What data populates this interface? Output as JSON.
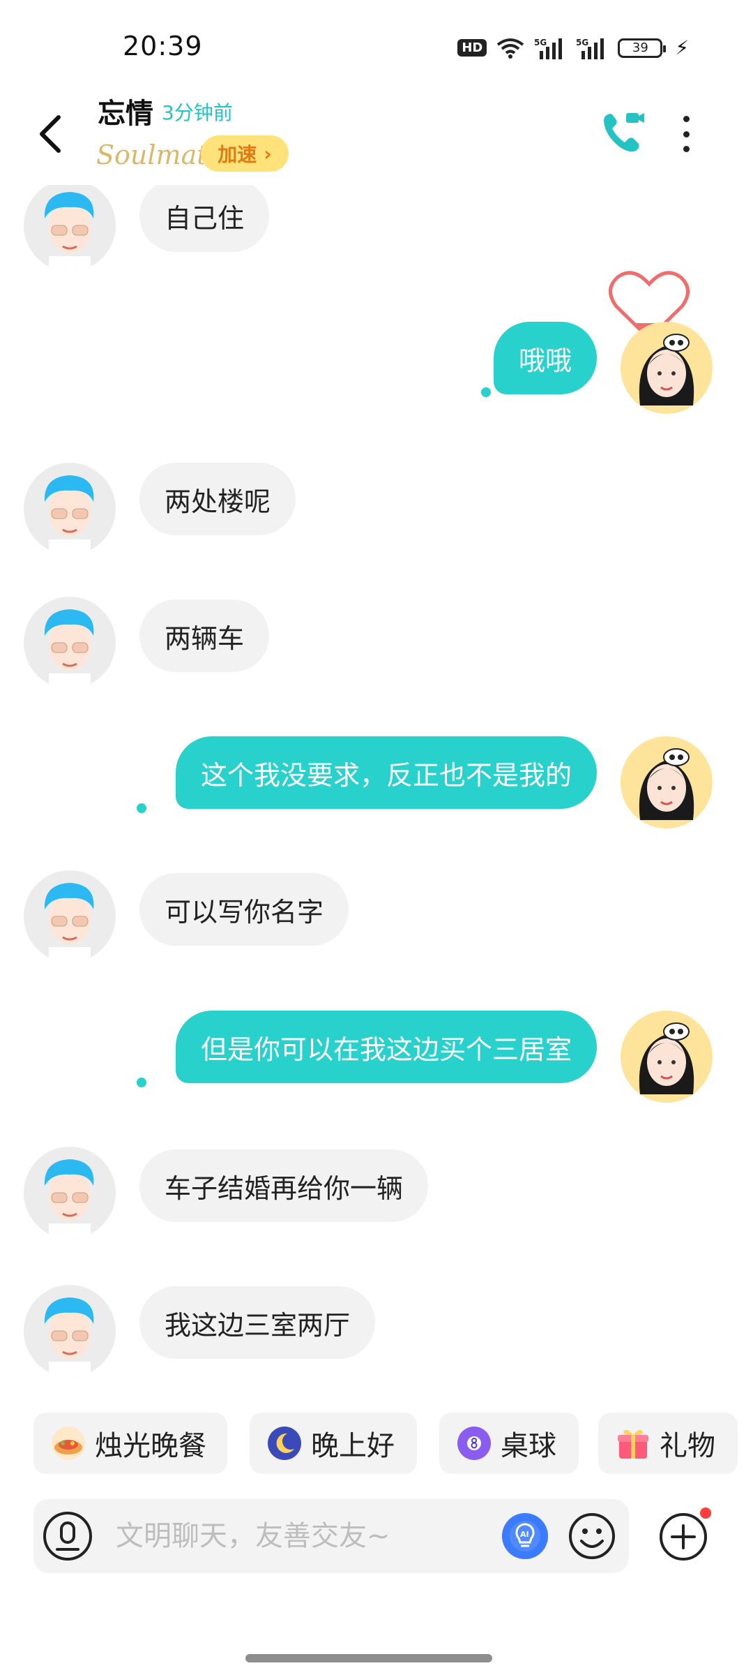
{
  "status_bar": {
    "time": "20:39",
    "hd_label": "HD",
    "signal_1": "5G",
    "signal_2": "5G",
    "battery": "39"
  },
  "header": {
    "contact_name": "忘情",
    "last_seen": "3分钟前",
    "brand": "Soulmate",
    "boost_label": "加速",
    "boost_chevron": "›"
  },
  "messages": [
    {
      "side": "other",
      "text": "自己住"
    },
    {
      "side": "me",
      "text": "哦哦"
    },
    {
      "side": "other",
      "text": "两处楼呢"
    },
    {
      "side": "other",
      "text": "两辆车"
    },
    {
      "side": "me",
      "text": "这个我没要求，反正也不是我的"
    },
    {
      "side": "other",
      "text": "可以写你名字"
    },
    {
      "side": "me",
      "text": "但是你可以在我这边买个三居室"
    },
    {
      "side": "other",
      "text": "车子结婚再给你一辆"
    },
    {
      "side": "other",
      "text": "我这边三室两厅"
    }
  ],
  "quick_replies": [
    {
      "label": "烛光晚餐",
      "icon": "candlelight-dinner-icon"
    },
    {
      "label": "晚上好",
      "icon": "moon-icon"
    },
    {
      "label": "桌球",
      "icon": "billiard-ball-icon"
    },
    {
      "label": "礼物",
      "icon": "gift-icon"
    }
  ],
  "input": {
    "placeholder": "文明聊天，友善交友~",
    "value": ""
  },
  "colors": {
    "accent": "#29d1cd",
    "boost_bg": "#ffe27a",
    "boost_text": "#e07b12",
    "notification": "#ff3b3b"
  }
}
